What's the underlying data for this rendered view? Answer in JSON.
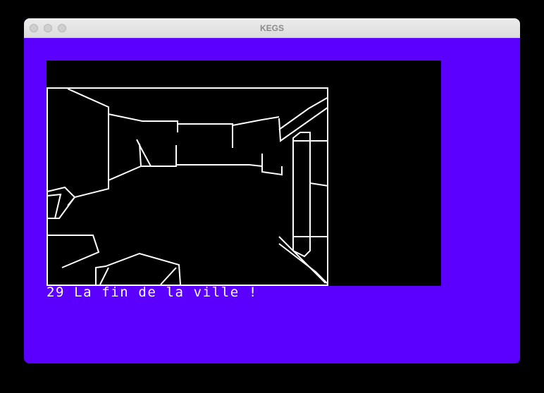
{
  "window": {
    "title": "KEGS"
  },
  "colors": {
    "border": "#5b00ff",
    "screen": "#000000",
    "line": "#ffffff"
  },
  "game": {
    "caption": "29 La fin de la ville !"
  }
}
